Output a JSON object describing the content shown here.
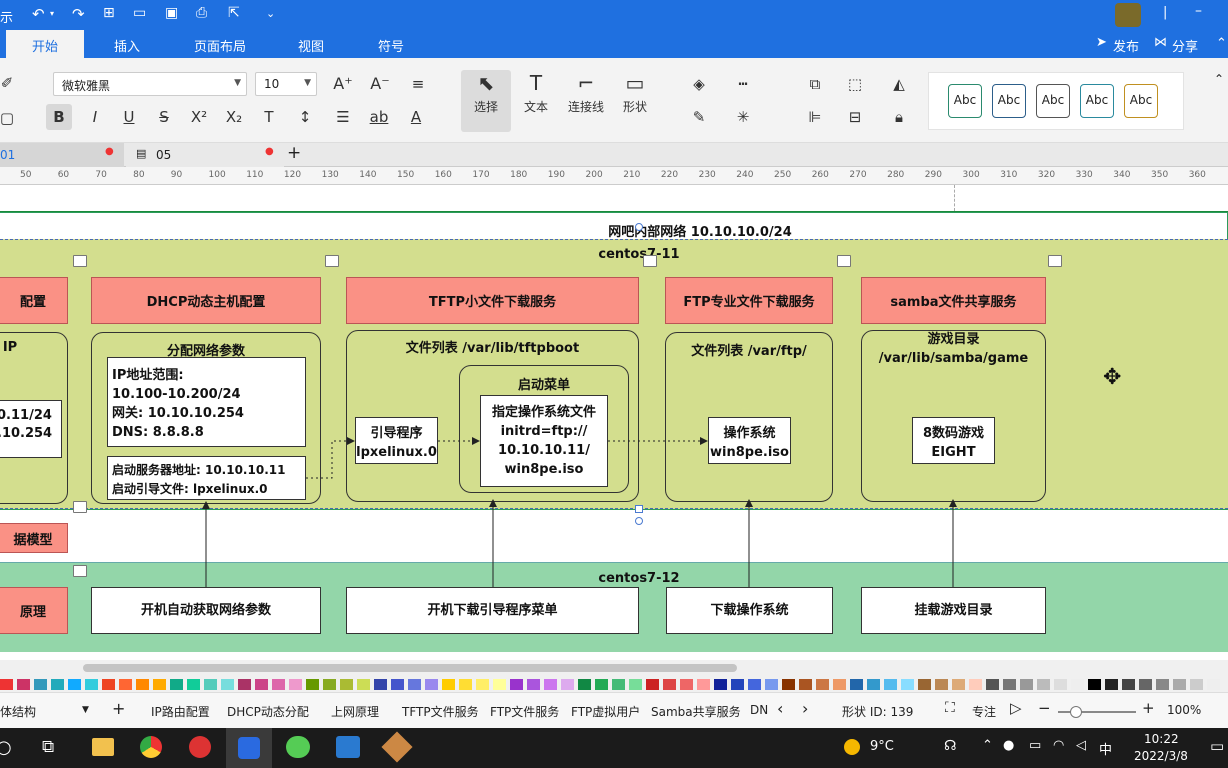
{
  "titlebar": {
    "left_text": "示",
    "avatar": "avatar"
  },
  "ribbon_tabs": [
    "开始",
    "插入",
    "页面布局",
    "视图",
    "符号"
  ],
  "ribbon_right": {
    "publish": "发布",
    "share": "分享"
  },
  "toolbar": {
    "font_name": "微软雅黑",
    "font_size": "10",
    "select_label": "选择",
    "text_label": "文本",
    "connector_label": "连接线",
    "shape_label": "形状",
    "style_sample": "Abc"
  },
  "doc_tabs": [
    {
      "label": "01"
    },
    {
      "label": "05"
    }
  ],
  "ruler_ticks": [
    "50",
    "60",
    "70",
    "80",
    "90",
    "100",
    "110",
    "120",
    "130",
    "140",
    "150",
    "160",
    "170",
    "180",
    "190",
    "200",
    "210",
    "220",
    "230",
    "240",
    "250",
    "260",
    "270",
    "280",
    "290",
    "300",
    "310",
    "320",
    "330",
    "340",
    "350",
    "360"
  ],
  "diagram": {
    "top_title": "网吧内部网络 10.10.10.0/24",
    "server_title": "centos7-11",
    "client_title": "centos7-12",
    "left_header_partial": "配置",
    "left_ip_partial": "IP",
    "left_ip_values": [
      "0.11/24",
      ".10.254"
    ],
    "model_partial": "据模型",
    "principle_partial": "原理",
    "dhcp": {
      "header": "DHCP动态主机配置",
      "subtitle": "分配网络参数",
      "params": [
        "IP地址范围:",
        "10.100-10.200/24",
        "网关: 10.10.10.254",
        "DNS:  8.8.8.8"
      ],
      "boot": [
        "启动服务器地址: 10.10.10.11",
        "启动引导文件:  lpxelinux.0"
      ],
      "client": "开机自动获取网络参数"
    },
    "tftp": {
      "header": "TFTP小文件下载服务",
      "filelist": "文件列表 /var/lib/tftpboot",
      "bootloader": [
        "引导程序",
        "lpxelinux.0"
      ],
      "menu_title": "启动菜单",
      "menu_content": [
        "指定操作系统文件",
        "initrd=ftp://",
        "10.10.10.11/",
        "win8pe.iso"
      ],
      "client": "开机下载引导程序菜单"
    },
    "ftp": {
      "header": "FTP专业文件下载服务",
      "filelist": "文件列表 /var/ftp/",
      "os": [
        "操作系统",
        "win8pe.iso"
      ],
      "client": "下载操作系统"
    },
    "samba": {
      "header": "samba文件共享服务",
      "dir": [
        "游戏目录",
        "/var/lib/samba/game"
      ],
      "game": [
        "8数码游戏",
        "EIGHT"
      ],
      "client": "挂载游戏目录"
    }
  },
  "sheet_tabs": [
    "体结构",
    "IP路由配置",
    "DHCP动态分配",
    "上网原理",
    "TFTP文件服务",
    "FTP文件服务",
    "FTP虚拟用户",
    "Samba共享服务",
    "DN"
  ],
  "status": {
    "shape_id": "形状 ID: 139",
    "focus": "专注",
    "zoom": "100%"
  },
  "taskbar": {
    "temperature": "9°C",
    "ime": "中",
    "time": "10:22",
    "date": "2022/3/8"
  },
  "colors": {
    "ribbon": "#1f70e0",
    "server_bg": "#d3de8e",
    "client_bg": "#93d6a9",
    "red_header": "#fa9185"
  }
}
